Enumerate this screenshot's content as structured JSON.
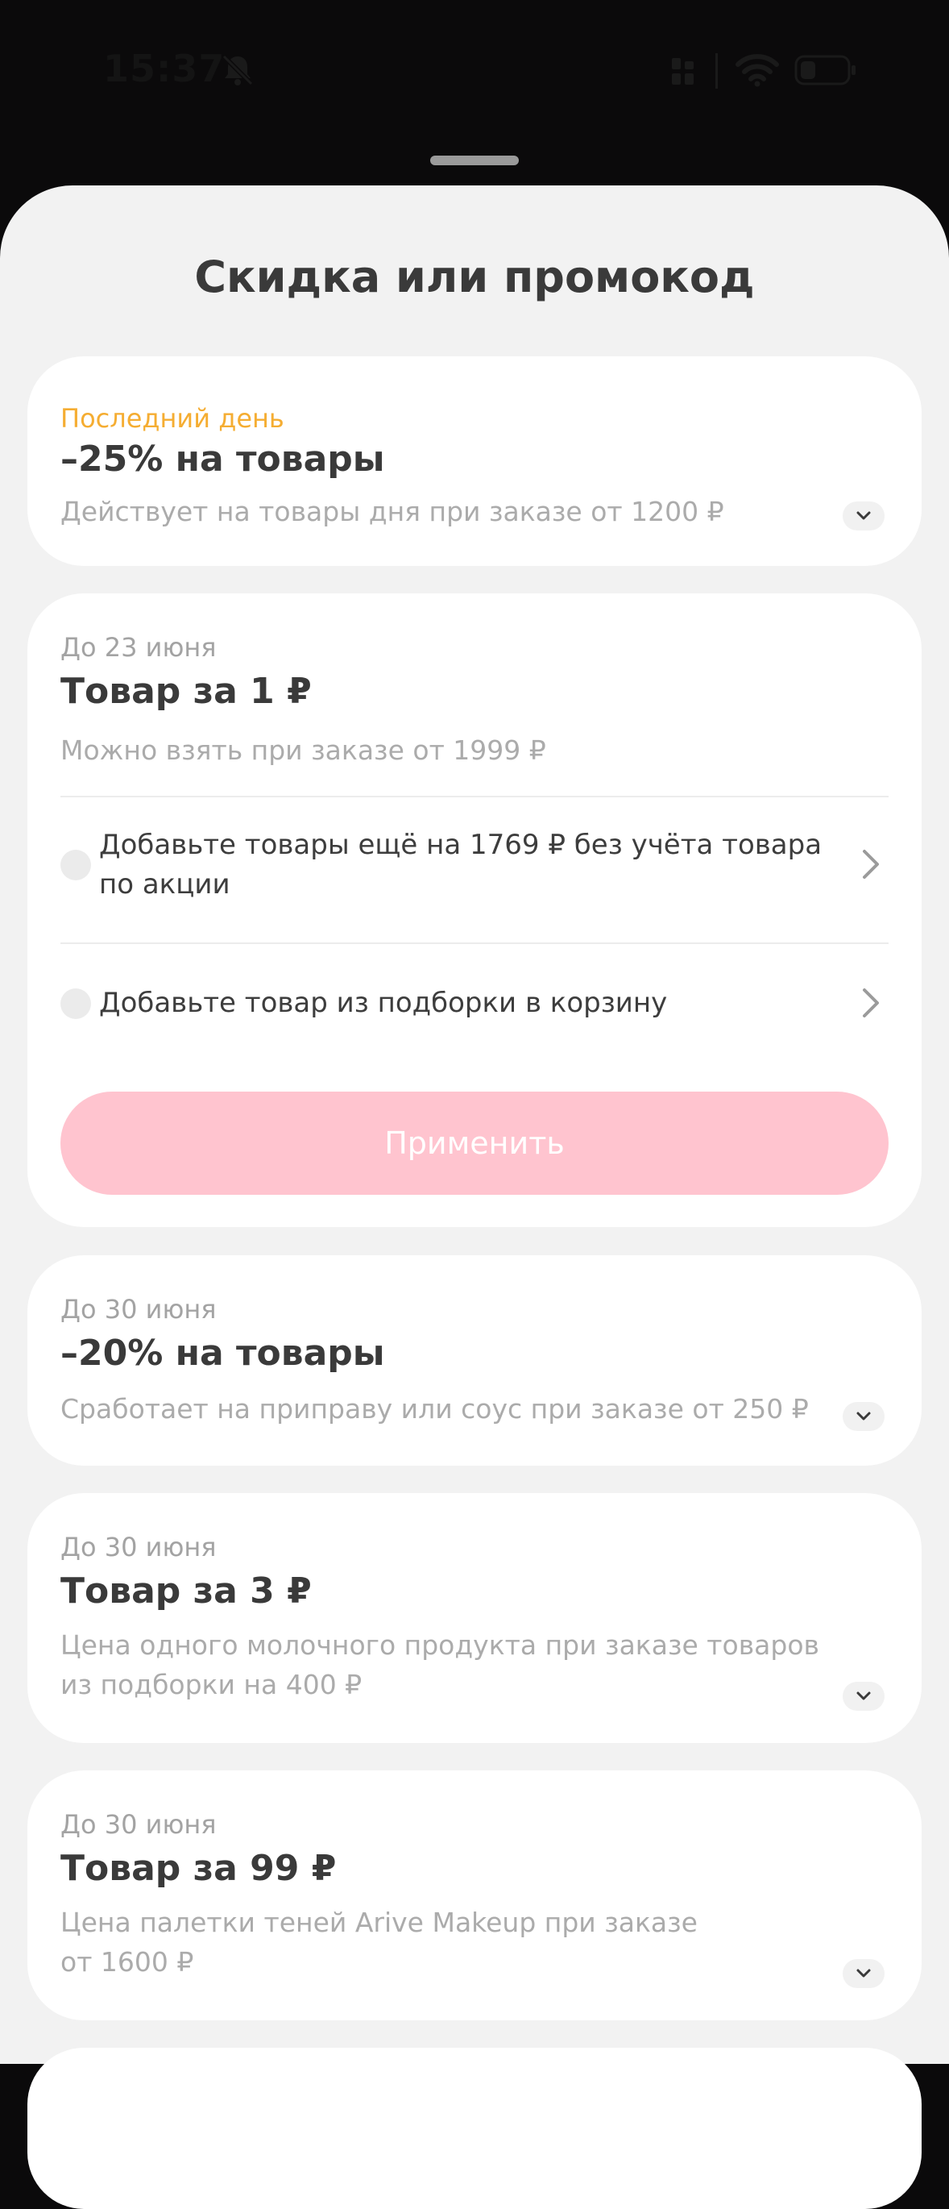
{
  "status_bar": {
    "time": "15:37"
  },
  "sheet": {
    "title": "Скидка или промокод"
  },
  "promos": [
    {
      "tag": "Последний день",
      "heading": "–25% на товары",
      "description": "Действует на товары дня при заказе от 1200 ₽"
    },
    {
      "tag": "До 23 июня",
      "heading": "Товар за 1 ₽",
      "description": "Можно взять при заказе от 1999 ₽",
      "conditions": [
        "Добавьте товары ещё на 1769 ₽ без учёта товара по акции",
        "Добавьте товар из подборки в корзину"
      ],
      "apply_label": "Применить"
    },
    {
      "tag": "До 30 июня",
      "heading": "–20% на товары",
      "description": "Сработает на приправу или соус при заказе от 250 ₽"
    },
    {
      "tag": "До 30 июня",
      "heading": "Товар за 3 ₽",
      "description": "Цена одного молочного продукта при заказе товаров из подборки на 400 ₽"
    },
    {
      "tag": "До 30 июня",
      "heading": "Товар за 99 ₽",
      "description": "Цена палетки теней Arive Makeup при заказе от 1600 ₽"
    }
  ],
  "colors": {
    "urgent_tag": "#f5ad32",
    "apply_button_disabled": "#ffc4cf",
    "sheet_background": "#f2f2f2"
  }
}
